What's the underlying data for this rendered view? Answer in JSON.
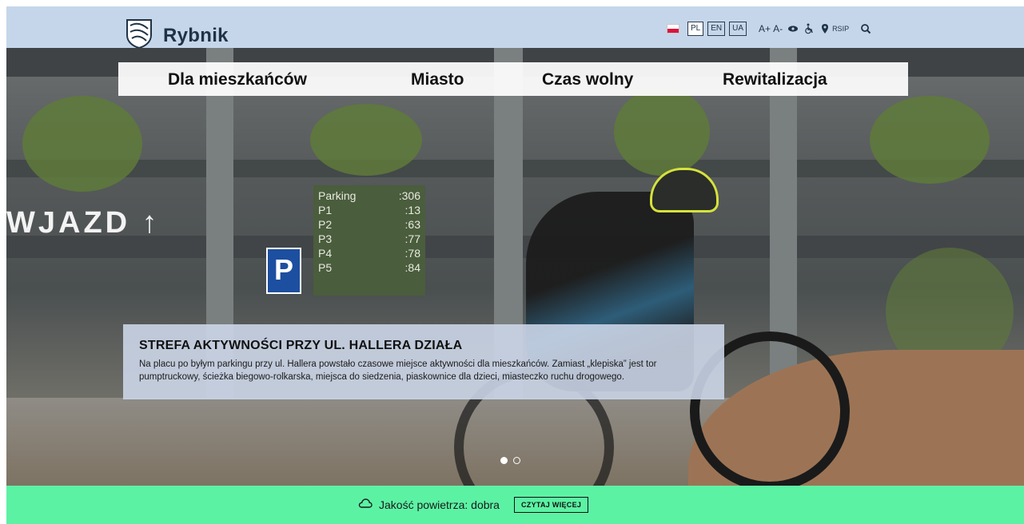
{
  "header": {
    "logo_text": "Rybnik",
    "languages": [
      "PL",
      "EN",
      "UA"
    ],
    "font_increase": "A+",
    "font_decrease": "A-",
    "rsip_label": "RSIP",
    "icons": [
      "poland-flag-icon",
      "eye-icon",
      "accessibility-icon",
      "location-pin-icon",
      "search-icon"
    ]
  },
  "nav": {
    "items": [
      "Dla mieszkańców",
      "Miasto",
      "Czas wolny",
      "Rewitalizacja"
    ]
  },
  "hero": {
    "wjazd_text": "WJAZD ↑",
    "parking": [
      {
        "label": "Parking",
        "value": ":306"
      },
      {
        "label": "P1",
        "value": ":13"
      },
      {
        "label": "P2",
        "value": ":63"
      },
      {
        "label": "P3",
        "value": ":77"
      },
      {
        "label": "P4",
        "value": ":78"
      },
      {
        "label": "P5",
        "value": ":84"
      }
    ],
    "p_sign": "P",
    "slide_title": "STREFA AKTYWNOŚCI PRZY UL. HALLERA DZIAŁA",
    "slide_text": "Na placu po byłym parkingu przy ul. Hallera powstało czasowe miejsce aktywności dla mieszkańców. Zamiast „klepiska” jest tor pumptruckowy, ścieżka biegowo-rolkarska, miejsca do siedzenia, piaskownice dla dzieci, miasteczko ruchu drogowego.",
    "slides_total": 2,
    "slide_active": 1
  },
  "air_quality": {
    "text": "Jakość powietrza: dobra",
    "button": "CZYTAJ WIĘCEJ",
    "icon": "cloud-icon"
  },
  "colors": {
    "header_bg": "#c6d6ea",
    "caption_bg": "#ced8eb",
    "air_bg": "#5cf2a4",
    "brand_text": "#1f3346"
  }
}
